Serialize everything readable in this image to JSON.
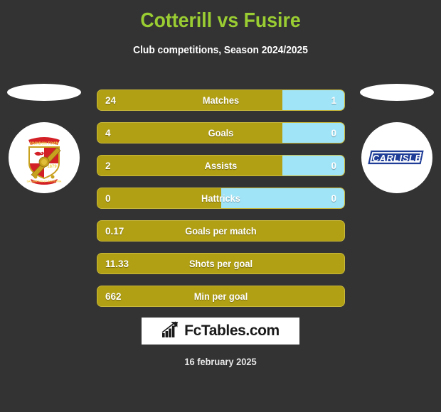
{
  "header": {
    "title": "Cotterill vs Fusire",
    "subtitle": "Club competitions, Season 2024/2025",
    "title_color": "#9ACD32"
  },
  "colors": {
    "background": "#333333",
    "bar_left": "#B1A014",
    "bar_right": "#A0E4F8",
    "bar_border": "#C9B93B",
    "text": "#FFFFFF"
  },
  "teams": {
    "left": {
      "logo_name": "swindon-town-crest",
      "crest_year": "1879",
      "crest_colors": [
        "#D32027",
        "#FFFFFF",
        "#C8A21E"
      ]
    },
    "right": {
      "logo_name": "carlisle-logo",
      "wordmark": "CARLISLE",
      "wordmark_color": "#1F3C97"
    }
  },
  "stats": [
    {
      "label": "Matches",
      "left": "24",
      "right": "1",
      "left_pct": 75,
      "right_pct": 25,
      "split": true
    },
    {
      "label": "Goals",
      "left": "4",
      "right": "0",
      "left_pct": 75,
      "right_pct": 25,
      "split": true
    },
    {
      "label": "Assists",
      "left": "2",
      "right": "0",
      "left_pct": 75,
      "right_pct": 25,
      "split": true
    },
    {
      "label": "Hattricks",
      "left": "0",
      "right": "0",
      "left_pct": 50,
      "right_pct": 50,
      "split": true
    },
    {
      "label": "Goals per match",
      "left": "0.17",
      "right": "",
      "left_pct": 100,
      "right_pct": 0,
      "split": false
    },
    {
      "label": "Shots per goal",
      "left": "11.33",
      "right": "",
      "left_pct": 100,
      "right_pct": 0,
      "split": false
    },
    {
      "label": "Min per goal",
      "left": "662",
      "right": "",
      "left_pct": 100,
      "right_pct": 0,
      "split": false
    }
  ],
  "footer": {
    "brand": "FcTables.com",
    "brand_icon": "bar-chart-growth-icon",
    "date": "16 february 2025"
  }
}
